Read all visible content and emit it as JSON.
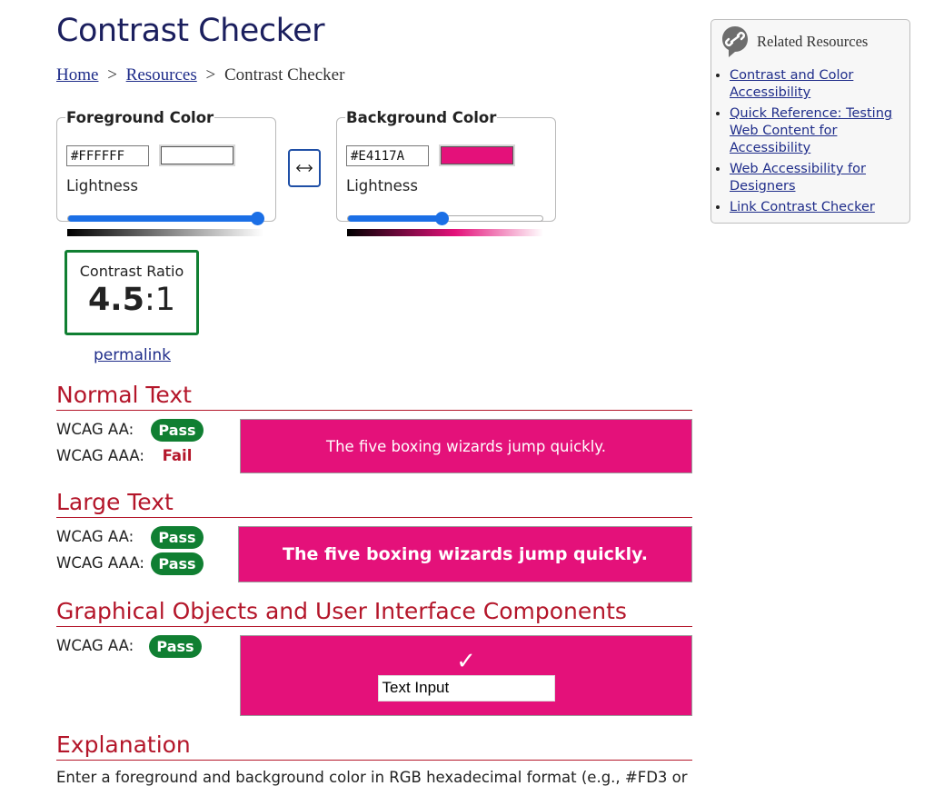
{
  "page": {
    "title": "Contrast Checker",
    "breadcrumb": [
      {
        "label": "Home"
      },
      {
        "label": "Resources"
      },
      {
        "label": "Contrast Checker"
      }
    ],
    "breadcrumb_separator": ">"
  },
  "foreground": {
    "legend": "Foreground Color",
    "hex_value": "#FFFFFF",
    "swatch_color": "#FFFFFF",
    "lightness_label": "Lightness",
    "lightness_percent": 97
  },
  "background": {
    "legend": "Background Color",
    "hex_value": "#E4117A",
    "swatch_color": "#E4117A",
    "lightness_label": "Lightness",
    "lightness_percent": 48
  },
  "swap": {
    "icon": "swap-arrows-icon"
  },
  "contrast": {
    "label": "Contrast Ratio",
    "ratio_number": "4.5",
    "ratio_suffix": ":1",
    "permalink_label": "permalink"
  },
  "normal_text": {
    "heading": "Normal Text",
    "aa_label": "WCAG AA:",
    "aa_result": "Pass",
    "aaa_label": "WCAG AAA:",
    "aaa_result": "Fail",
    "sample": "The five boxing wizards jump quickly."
  },
  "large_text": {
    "heading": "Large Text",
    "aa_label": "WCAG AA:",
    "aa_result": "Pass",
    "aaa_label": "WCAG AAA:",
    "aaa_result": "Pass",
    "sample": "The five boxing wizards jump quickly."
  },
  "graphical": {
    "heading": "Graphical Objects and User Interface Components",
    "aa_label": "WCAG AA:",
    "aa_result": "Pass",
    "checkmark": "✓",
    "text_input_value": "Text Input"
  },
  "explanation": {
    "heading": "Explanation",
    "text": "Enter a foreground and background color in RGB hexadecimal format (e.g., #FD3 or"
  },
  "related": {
    "title": "Related Resources",
    "icon": "link-icon",
    "links": [
      {
        "label": "Contrast and Color Accessibility"
      },
      {
        "label": "Quick Reference: Testing Web Content for Accessibility"
      },
      {
        "label": "Web Accessibility for Designers"
      },
      {
        "label": "Link Contrast Checker"
      }
    ]
  },
  "colors": {
    "pass_green": "#107F32",
    "fail_red": "#B4162A",
    "slider_blue": "#1B6FE6",
    "title_navy": "#1B1F5E"
  }
}
